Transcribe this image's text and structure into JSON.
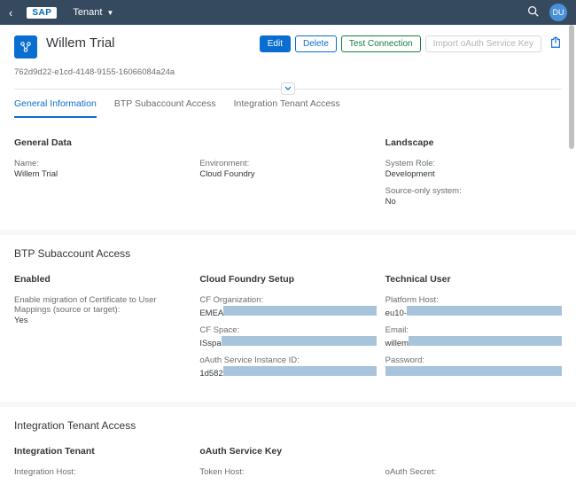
{
  "shell": {
    "tenant_label": "Tenant",
    "user_initials": "DU",
    "logo_text": "SAP"
  },
  "header": {
    "title": "Willem Trial",
    "guid": "762d9d22-e1cd-4148-9155-16066084a24a",
    "actions": {
      "edit": "Edit",
      "delete": "Delete",
      "test_connection": "Test Connection",
      "import_oauth": "Import oAuth Service Key"
    }
  },
  "tabs": {
    "general": "General Information",
    "btp": "BTP Subaccount Access",
    "integration": "Integration Tenant Access"
  },
  "general": {
    "section_title": "",
    "general_data": {
      "title": "General Data",
      "name_label": "Name:",
      "name_value": "Willem Trial",
      "env_label": "Environment:",
      "env_value": "Cloud Foundry"
    },
    "landscape": {
      "title": "Landscape",
      "role_label": "System Role:",
      "role_value": "Development",
      "source_label": "Source-only system:",
      "source_value": "No"
    }
  },
  "btp": {
    "section_title": "BTP Subaccount Access",
    "enabled": {
      "title": "Enabled",
      "migration_label": "Enable migration of Certificate to User Mappings (source or target):",
      "migration_value": "Yes"
    },
    "cf_setup": {
      "title": "Cloud Foundry Setup",
      "org_label": "CF Organization:",
      "org_prefix": "EMEA",
      "space_label": "CF Space:",
      "space_prefix": "ISspa",
      "instance_label": "oAuth Service Instance ID:",
      "instance_prefix": "1d582"
    },
    "tech_user": {
      "title": "Technical User",
      "host_label": "Platform Host:",
      "host_prefix": "eu10-",
      "email_label": "Email:",
      "email_prefix": "willem",
      "pw_label": "Password:"
    }
  },
  "integration": {
    "section_title": "Integration Tenant Access",
    "tenant": {
      "title": "Integration Tenant",
      "host_label": "Integration Host:"
    },
    "oauth_key": {
      "title": "oAuth Service Key",
      "token_label": "Token Host:"
    },
    "oauth_secret": {
      "secret_label": "oAuth Secret:"
    }
  }
}
